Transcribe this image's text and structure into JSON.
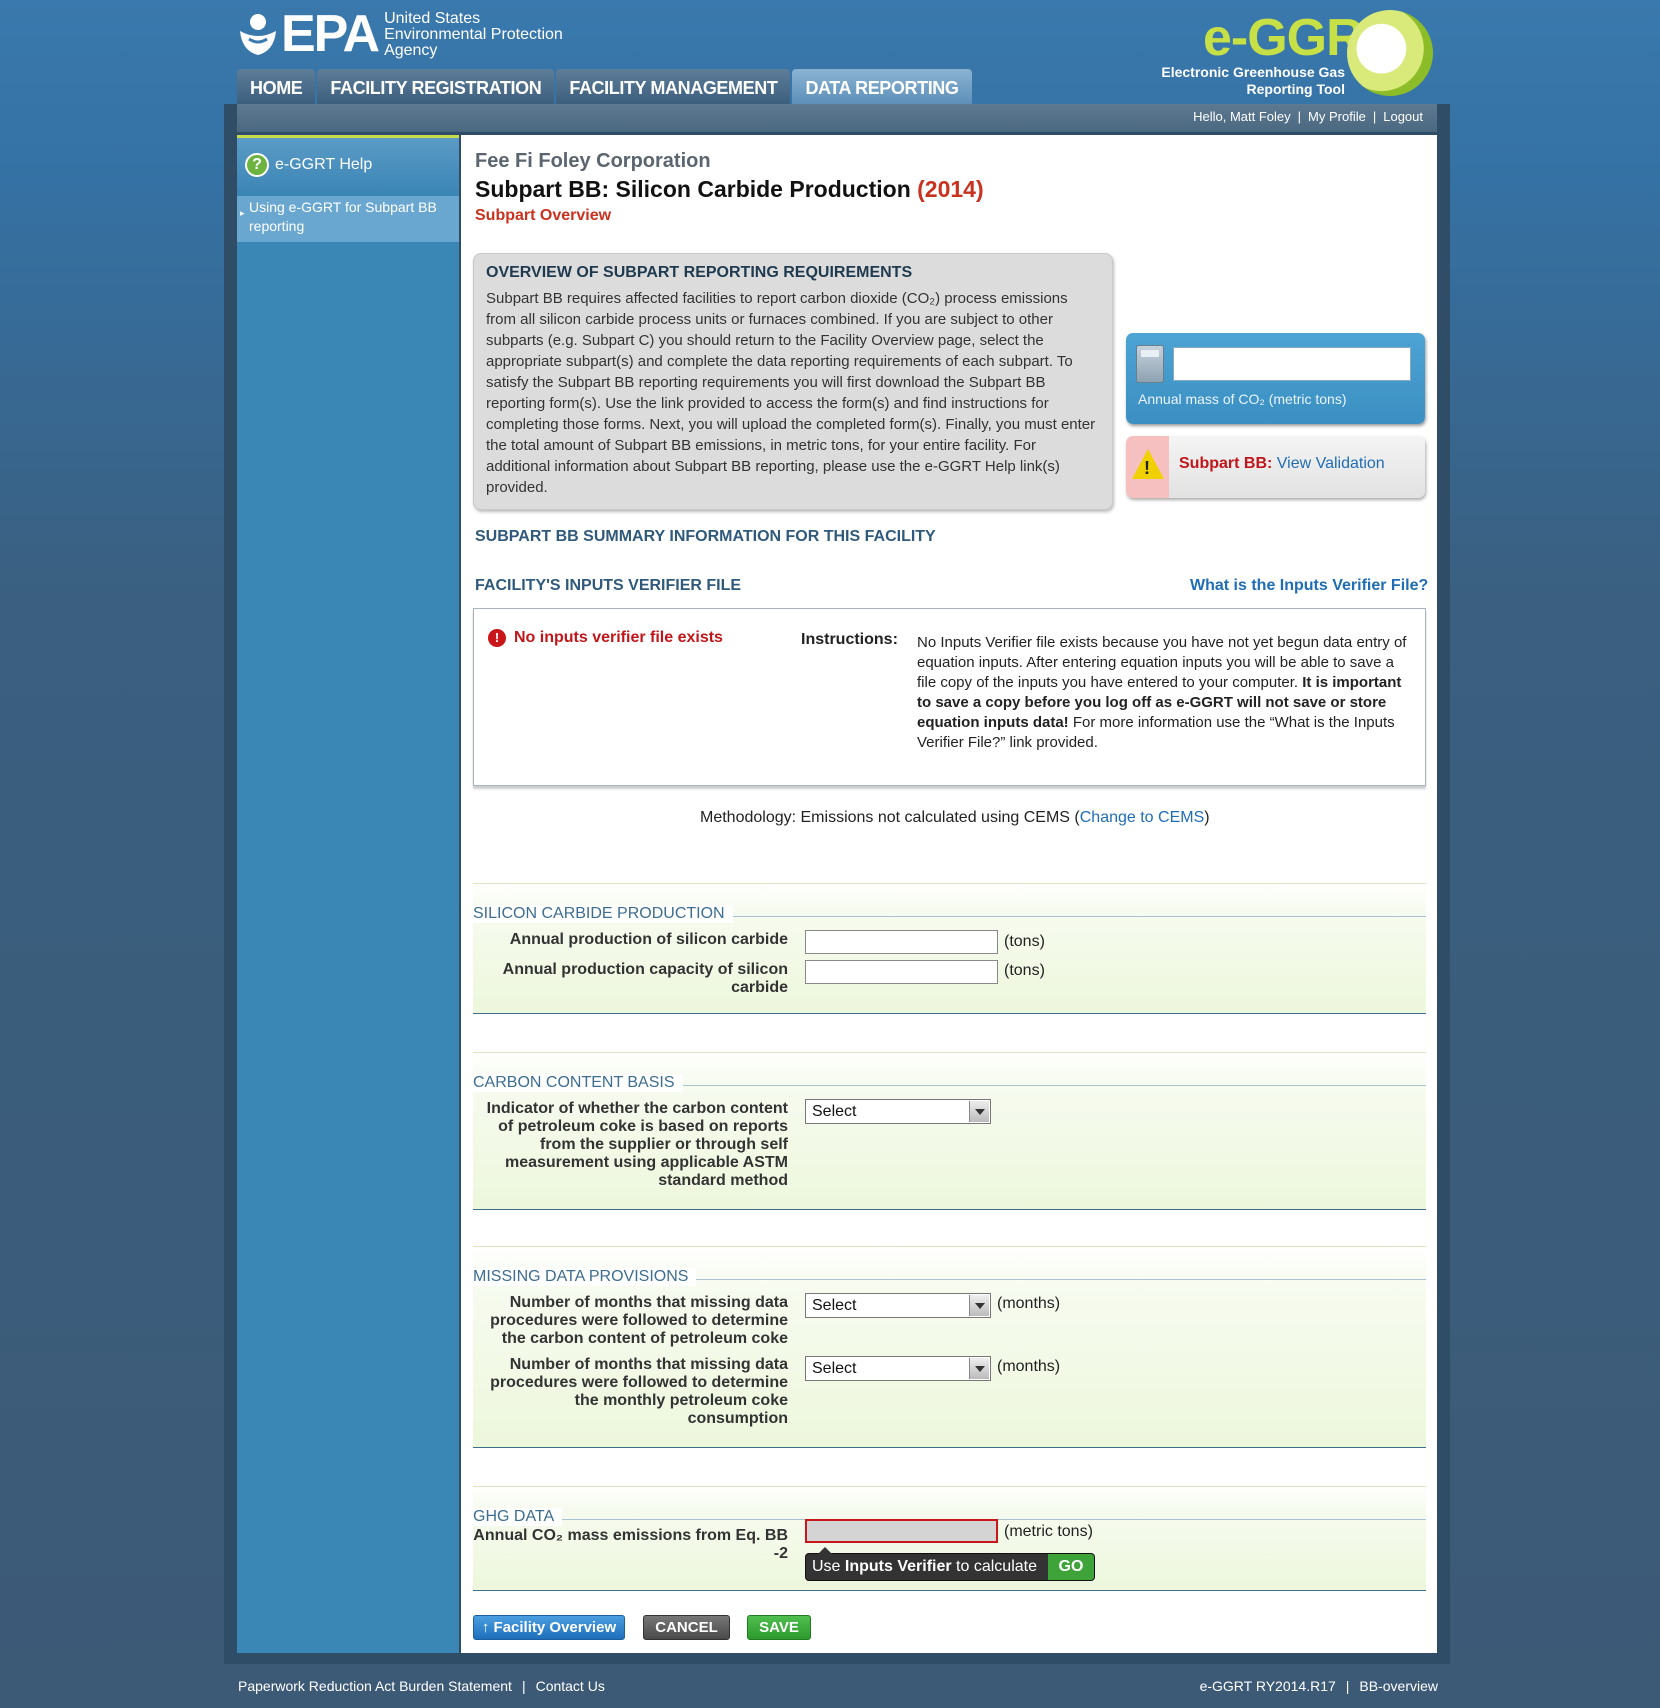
{
  "header": {
    "epa_word": "EPA",
    "epa_agency": [
      "United States",
      "Environmental Protection",
      "Agency"
    ],
    "tabs": [
      {
        "label": "HOME",
        "active": false
      },
      {
        "label": "FACILITY REGISTRATION",
        "active": false
      },
      {
        "label": "FACILITY MANAGEMENT",
        "active": false
      },
      {
        "label": "DATA REPORTING",
        "active": true
      }
    ],
    "logo_title": "e-GGRT",
    "logo_subtitle": [
      "Electronic Greenhouse Gas",
      "Reporting Tool"
    ]
  },
  "userbar": {
    "greeting": "Hello, Matt Foley",
    "profile": "My Profile",
    "logout": "Logout"
  },
  "sidebar": {
    "help_title": "e-GGRT Help",
    "help_link": "Using e-GGRT for Subpart BB reporting"
  },
  "page": {
    "company": "Fee Fi Foley Corporation",
    "title": "Subpart BB: Silicon Carbide Production",
    "year": "(2014)",
    "subtitle": "Subpart Overview"
  },
  "overview": {
    "heading": "OVERVIEW OF SUBPART REPORTING REQUIREMENTS",
    "body": "Subpart BB requires affected facilities to report carbon dioxide (CO₂) process emissions from all silicon carbide process units or furnaces combined. If you are subject to other subparts (e.g. Subpart C) you should return to the Facility Overview page, select the appropriate subpart(s) and complete the data reporting requirements of each subpart. To satisfy the Subpart BB reporting requirements you will first download the Subpart BB reporting form(s). Use the link provided to access the form(s) and find instructions for completing those forms. Next, you will upload the completed form(s). Finally, you must enter the total amount of Subpart BB emissions, in metric tons, for your entire facility. For additional information about Subpart BB reporting, please use the e-GGRT Help link(s) provided."
  },
  "calculator": {
    "value": "",
    "label": "Annual mass of CO₂ (metric tons)"
  },
  "validation": {
    "label": "Subpart BB:",
    "link": "View Validation"
  },
  "summary_heading": "SUBPART BB SUMMARY INFORMATION FOR THIS FACILITY",
  "inputs_verifier": {
    "heading": "FACILITY'S INPUTS VERIFIER FILE",
    "help_link": "What is the Inputs Verifier File?",
    "error": "No inputs verifier file exists",
    "instructions_label": "Instructions:",
    "instructions_part1": "No Inputs Verifier file exists because you have not yet begun data entry of equation inputs.  After entering equation inputs you will be able to save a file copy of the inputs you have entered to your computer.  ",
    "instructions_bold": "It is important to save a copy before you log off as e-GGRT will not save or store equation inputs data!",
    "instructions_part2": " For more information use the “What is the Inputs Verifier File?” link provided."
  },
  "methodology": {
    "prefix": "Methodology: Emissions not calculated using CEMS (",
    "link": "Change to CEMS",
    "suffix": ")"
  },
  "sections": {
    "production": {
      "title": "SILICON CARBIDE PRODUCTION",
      "annual_production_label": "Annual production of silicon carbide",
      "annual_production_value": "",
      "annual_production_unit": "(tons)",
      "capacity_label": "Annual production capacity of silicon carbide",
      "capacity_value": "",
      "capacity_unit": "(tons)"
    },
    "carbon": {
      "title": "CARBON CONTENT BASIS",
      "indicator_label": "Indicator of whether the carbon content of petroleum coke is based on reports from the supplier or through self measurement using applicable ASTM standard method",
      "indicator_value": "Select"
    },
    "missing": {
      "title": "MISSING DATA PROVISIONS",
      "carbon_months_label": "Number of months that missing data procedures were followed to determine the carbon content of petroleum coke",
      "carbon_months_value": "Select",
      "carbon_months_unit": "(months)",
      "consumption_months_label": "Number of months that missing data procedures were followed to determine the monthly petroleum coke consumption",
      "consumption_months_value": "Select",
      "consumption_months_unit": "(months)"
    },
    "ghg": {
      "title": "GHG DATA",
      "emissions_label": "Annual CO₂ mass emissions from Eq. BB -2",
      "emissions_value": "",
      "emissions_unit": "(metric tons)",
      "verifier_prefix": "Use ",
      "verifier_bold": "Inputs Verifier",
      "verifier_suffix": " to calculate",
      "go": "GO"
    }
  },
  "buttons": {
    "facility_overview": "Facility Overview",
    "cancel": "CANCEL",
    "save": "SAVE"
  },
  "footer": {
    "burden": "Paperwork Reduction Act Burden Statement",
    "contact": "Contact Us",
    "version": "e-GGRT RY2014.R17",
    "page_id": "BB-overview"
  }
}
